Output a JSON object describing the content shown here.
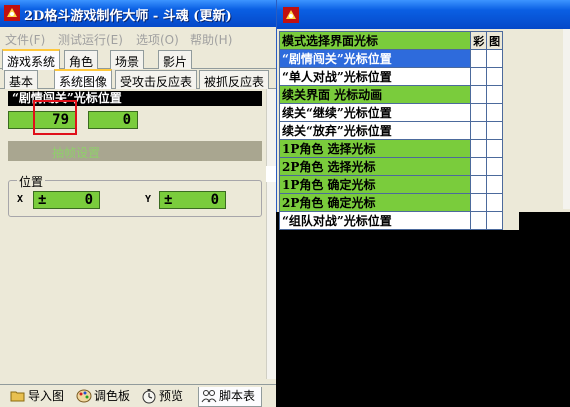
{
  "main_window": {
    "title": "2D格斗游戏制作大师 - 斗魂 (更新)",
    "menu": [
      "文件(F)",
      "测试运行(E)",
      "选项(O)",
      "帮助(H)"
    ],
    "top_tabs": [
      "游戏系统",
      "角色",
      "场景",
      "影片"
    ],
    "sub_tabs": [
      "基本",
      "系统图像",
      "受攻击反应表",
      "被抓反应表"
    ],
    "panel": {
      "header": "“剧情闯关”光标位置",
      "value_left": "79",
      "value_right": "0",
      "disabled_label": "抽帧设置",
      "position_group": {
        "legend": "位置",
        "x_label": "X",
        "x_sign": "±",
        "x_value": "0",
        "y_label": "Y",
        "y_sign": "±",
        "y_value": "0"
      }
    },
    "bottom_tabs": [
      "导入图",
      "调色板",
      "预览",
      "脚本表"
    ]
  },
  "side_window": {
    "table_header": {
      "name": "模式选择界面光标",
      "flag1": "彩",
      "flag2": "图"
    },
    "rows": [
      {
        "label": "“剧情闯关”光标位置",
        "style": "selected"
      },
      {
        "label": "“单人对战”光标位置",
        "style": "white"
      },
      {
        "label": "续关界面 光标动画",
        "style": "green"
      },
      {
        "label": "续关“继续”光标位置",
        "style": "white"
      },
      {
        "label": "续关“放弃”光标位置",
        "style": "white"
      },
      {
        "label": "1P角色 选择光标",
        "style": "green"
      },
      {
        "label": "2P角色 选择光标",
        "style": "green"
      },
      {
        "label": "1P角色 确定光标",
        "style": "green"
      },
      {
        "label": "2P角色 确定光标",
        "style": "green"
      },
      {
        "label": "“组队对战”光标位置",
        "style": "white"
      }
    ]
  },
  "colors": {
    "titlebar": "#0a5fe3",
    "value_green": "#7acc3c",
    "selected_row": "#2e6bdc",
    "highlight_frame": "#e0101a",
    "background_black": "#000000"
  }
}
